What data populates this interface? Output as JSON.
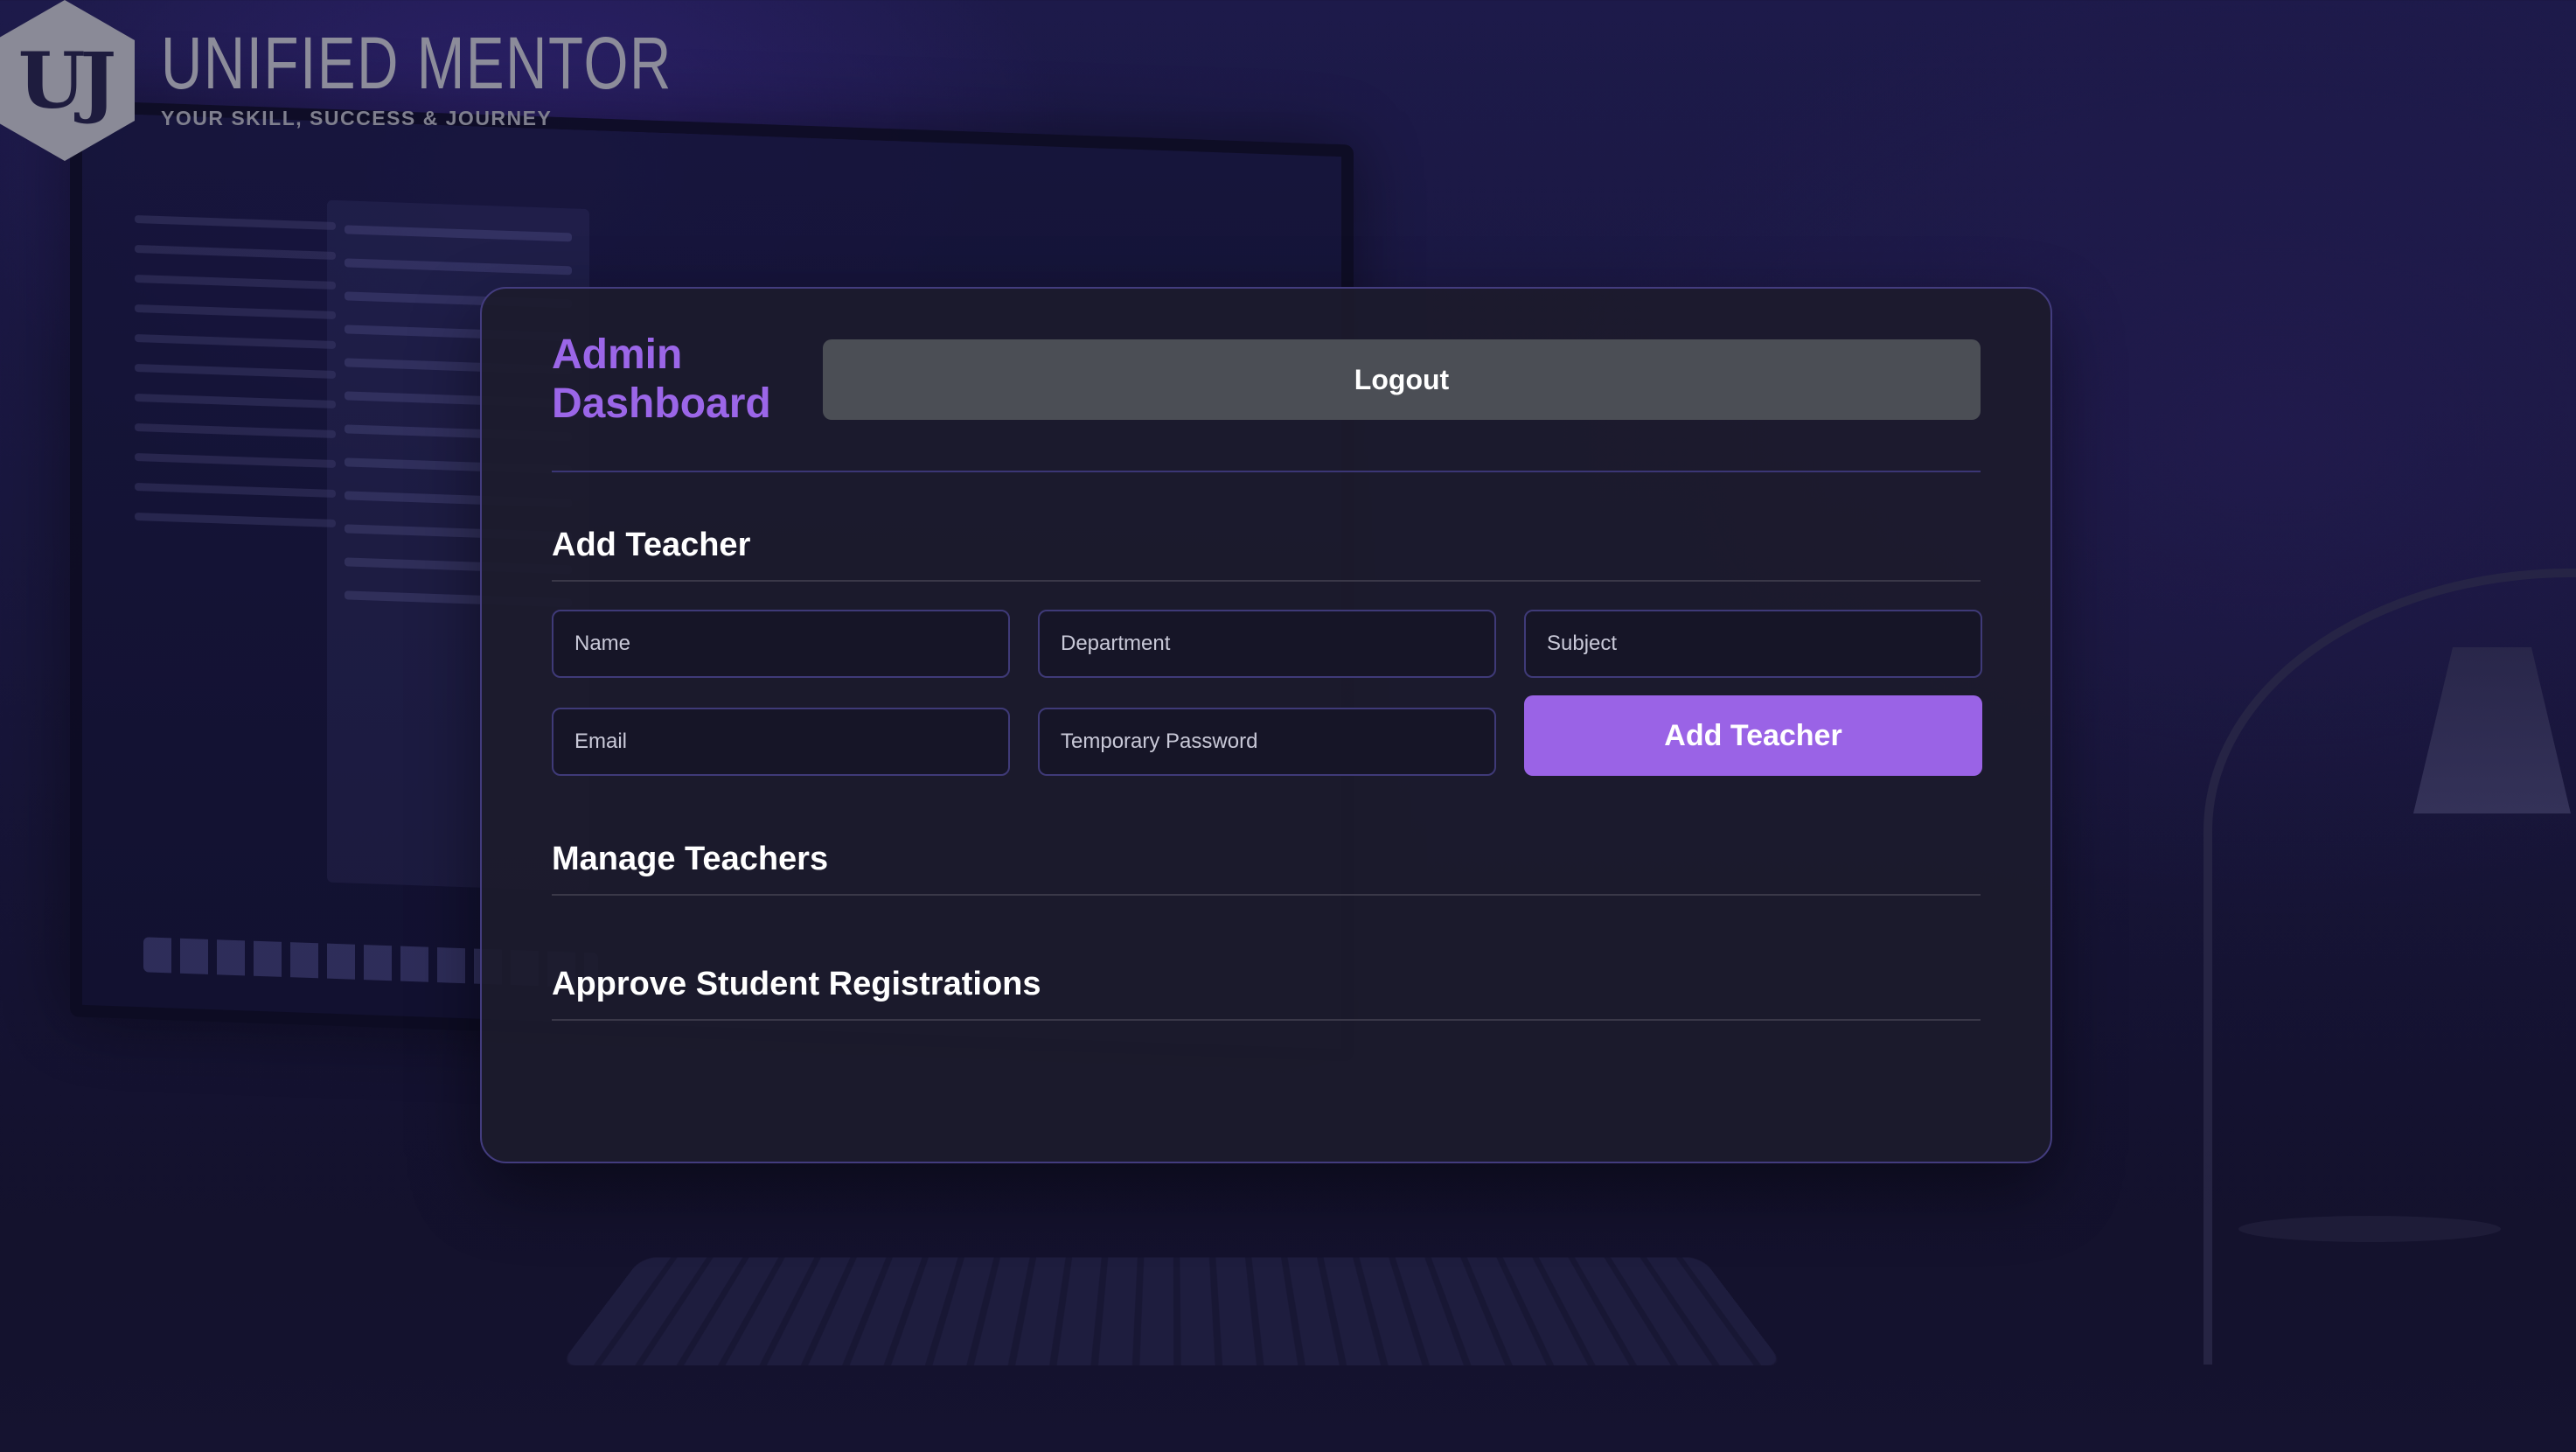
{
  "logo": {
    "mark": "UJ",
    "title": "UNIFIED MENTOR",
    "tagline": "YOUR SKILL, SUCCESS & JOURNEY"
  },
  "header": {
    "title": "Admin\nDashboard",
    "logout_label": "Logout"
  },
  "add_teacher": {
    "heading": "Add Teacher",
    "fields": {
      "name_placeholder": "Name",
      "department_placeholder": "Department",
      "subject_placeholder": "Subject",
      "email_placeholder": "Email",
      "password_placeholder": "Temporary Password"
    },
    "submit_label": "Add Teacher"
  },
  "manage_teachers": {
    "heading": "Manage Teachers"
  },
  "approve_students": {
    "heading": "Approve Student Registrations"
  },
  "colors": {
    "accent": "#9a63e6",
    "logout_bg": "#4b4e55",
    "border": "#433c7e"
  }
}
